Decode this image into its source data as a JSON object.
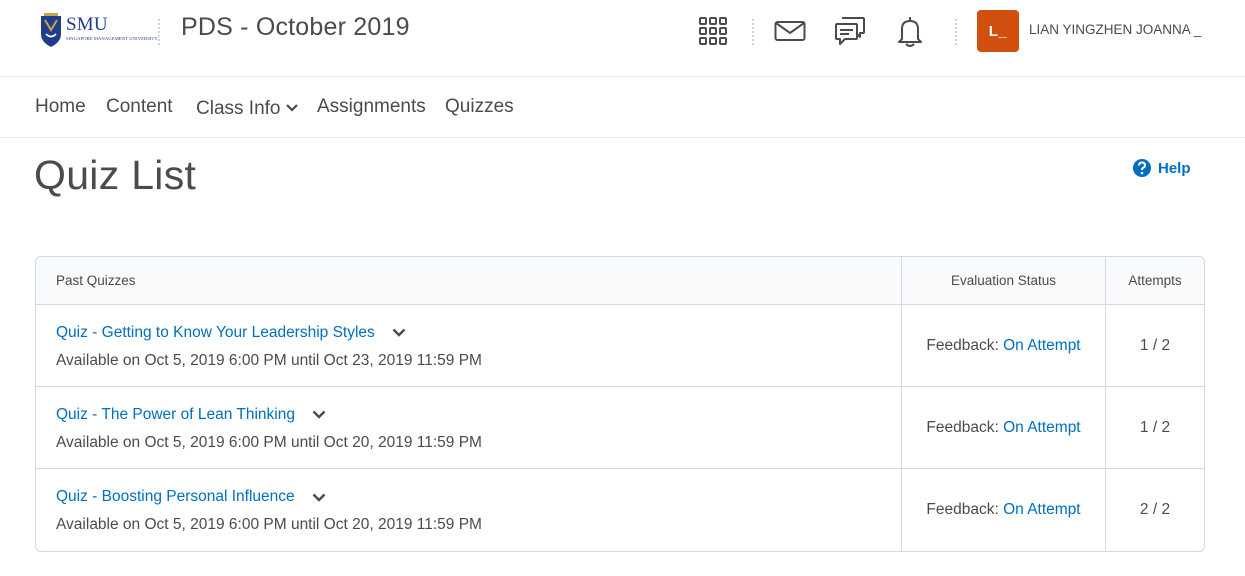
{
  "header": {
    "logo": {
      "text": "SMU",
      "subtext": "SINGAPORE MANAGEMENT UNIVERSITY"
    },
    "course_title": "PDS - October 2019",
    "icons": [
      "app-grid-icon",
      "mail-icon",
      "chat-icon",
      "bell-icon"
    ],
    "user": {
      "initial": "L_",
      "name": "LIAN YINGZHEN JOANNA _"
    },
    "accent_color": "#d14f0f"
  },
  "nav": {
    "items": [
      {
        "label": "Home"
      },
      {
        "label": "Content"
      },
      {
        "label": "Class Info"
      },
      {
        "label": "Assignments"
      },
      {
        "label": "Quizzes"
      }
    ]
  },
  "page": {
    "title": "Quiz List",
    "help_label": "Help",
    "link_color": "#006fbf"
  },
  "table": {
    "headers": {
      "name": "Past Quizzes",
      "evaluation": "Evaluation Status",
      "attempts": "Attempts"
    },
    "rows": [
      {
        "title": "Quiz - Getting to Know Your Leadership Styles",
        "availability": "Available on Oct 5, 2019 6:00 PM until Oct 23, 2019 11:59 PM",
        "feedback_label": "Feedback:",
        "feedback_value": "On Attempt",
        "attempts": "1 / 2"
      },
      {
        "title": "Quiz - The Power of Lean Thinking",
        "availability": "Available on Oct 5, 2019 6:00 PM until Oct 20, 2019 11:59 PM",
        "feedback_label": "Feedback:",
        "feedback_value": "On Attempt",
        "attempts": "1 / 2"
      },
      {
        "title": "Quiz - Boosting Personal Influence",
        "availability": "Available on Oct 5, 2019 6:00 PM until Oct 20, 2019 11:59 PM",
        "feedback_label": "Feedback:",
        "feedback_value": "On Attempt",
        "attempts": "2 / 2"
      }
    ]
  }
}
